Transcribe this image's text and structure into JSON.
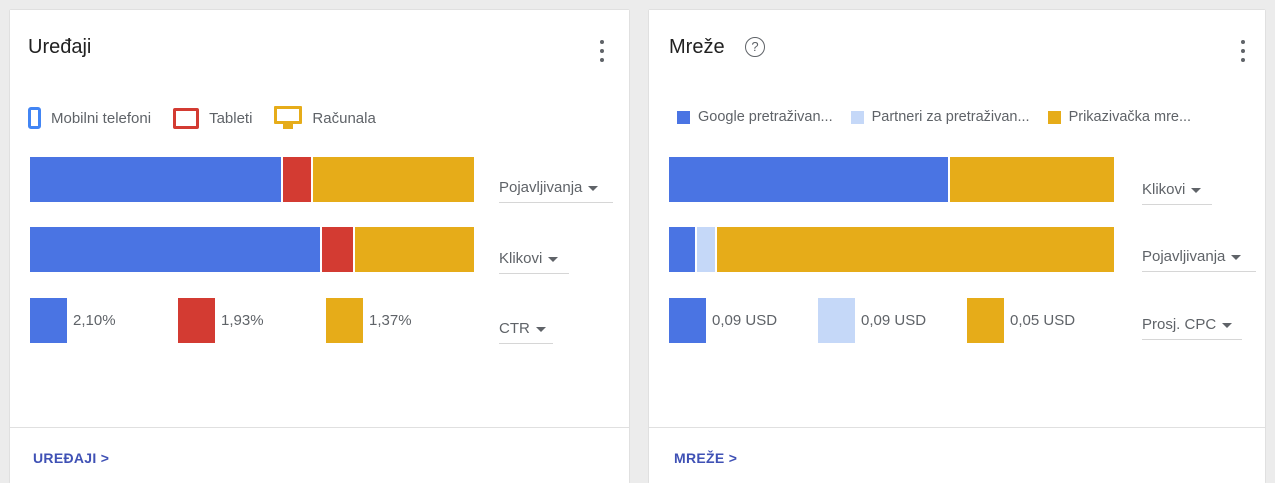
{
  "colors": {
    "blue": "#4a74e3",
    "red": "#d33b32",
    "yellow": "#e6ac19",
    "light_blue": "#c5d8f8"
  },
  "devices": {
    "title": "Uređaji",
    "legend": [
      {
        "label": "Mobilni telefoni",
        "icon": "phone-icon"
      },
      {
        "label": "Tableti",
        "icon": "tablet-icon"
      },
      {
        "label": "Računala",
        "icon": "desktop-icon"
      }
    ],
    "rows": [
      {
        "metric": "Pojavljivanja",
        "shares": [
          0.57,
          0.065,
          0.365
        ]
      },
      {
        "metric": "Klikovi",
        "shares": [
          0.66,
          0.07,
          0.27
        ]
      }
    ],
    "ctr": {
      "metric": "CTR",
      "values": [
        "2,10%",
        "1,93%",
        "1,37%"
      ]
    },
    "footer_link": "UREĐAJI >"
  },
  "networks": {
    "title": "Mreže",
    "help_icon": "?",
    "legend": [
      {
        "label": "Google pretraživan..."
      },
      {
        "label": "Partneri za pretraživan..."
      },
      {
        "label": "Prikazivačka mre..."
      }
    ],
    "rows": [
      {
        "metric": "Klikovi",
        "shares": [
          0.63,
          0.0,
          0.37
        ]
      },
      {
        "metric": "Pojavljivanja",
        "shares": [
          0.06,
          0.04,
          0.9
        ]
      }
    ],
    "cpc": {
      "metric": "Prosj. CPC",
      "values": [
        "0,09 USD",
        "0,09 USD",
        "0,05 USD"
      ]
    },
    "footer_link": "MREŽE >"
  }
}
